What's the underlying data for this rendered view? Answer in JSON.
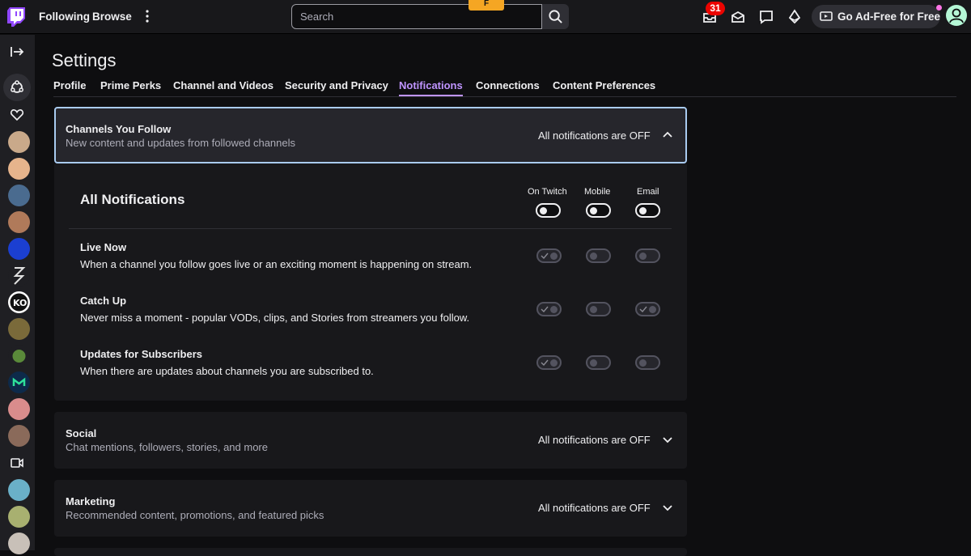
{
  "topnav": {
    "following": "Following",
    "browse": "Browse",
    "search_placeholder": "Search",
    "promo_tag": "F",
    "inbox_badge": "31",
    "adfree_label": "Go Ad-Free for Free"
  },
  "settings": {
    "title": "Settings",
    "tabs": [
      {
        "label": "Profile"
      },
      {
        "label": "Prime Perks"
      },
      {
        "label": "Channel and Videos"
      },
      {
        "label": "Security and Privacy"
      },
      {
        "label": "Notifications",
        "active": true
      },
      {
        "label": "Connections"
      },
      {
        "label": "Content Preferences"
      }
    ]
  },
  "sections": {
    "channels": {
      "title": "Channels You Follow",
      "subtitle": "New content and updates from followed channels",
      "status": "All notifications are OFF",
      "expanded": true
    },
    "social": {
      "title": "Social",
      "subtitle": "Chat mentions, followers, stories, and more",
      "status": "All notifications are OFF"
    },
    "marketing": {
      "title": "Marketing",
      "subtitle": "Recommended content, promotions, and featured picks",
      "status": "All notifications are OFF"
    }
  },
  "panel": {
    "all_title": "All Notifications",
    "columns": [
      "On Twitch",
      "Mobile",
      "Email"
    ],
    "rows": [
      {
        "title": "Live Now",
        "desc": "When a channel you follow goes live or an exciting moment is happening on stream."
      },
      {
        "title": "Catch Up",
        "desc": "Never miss a moment - popular VODs, clips, and Stories from streamers you follow."
      },
      {
        "title": "Updates for Subscribers",
        "desc": "When there are updates about channels you are subscribed to."
      }
    ]
  },
  "colors": {
    "accent": "#bf94ff",
    "focus_border": "#a9cbf0",
    "badge": "#eb0400"
  }
}
